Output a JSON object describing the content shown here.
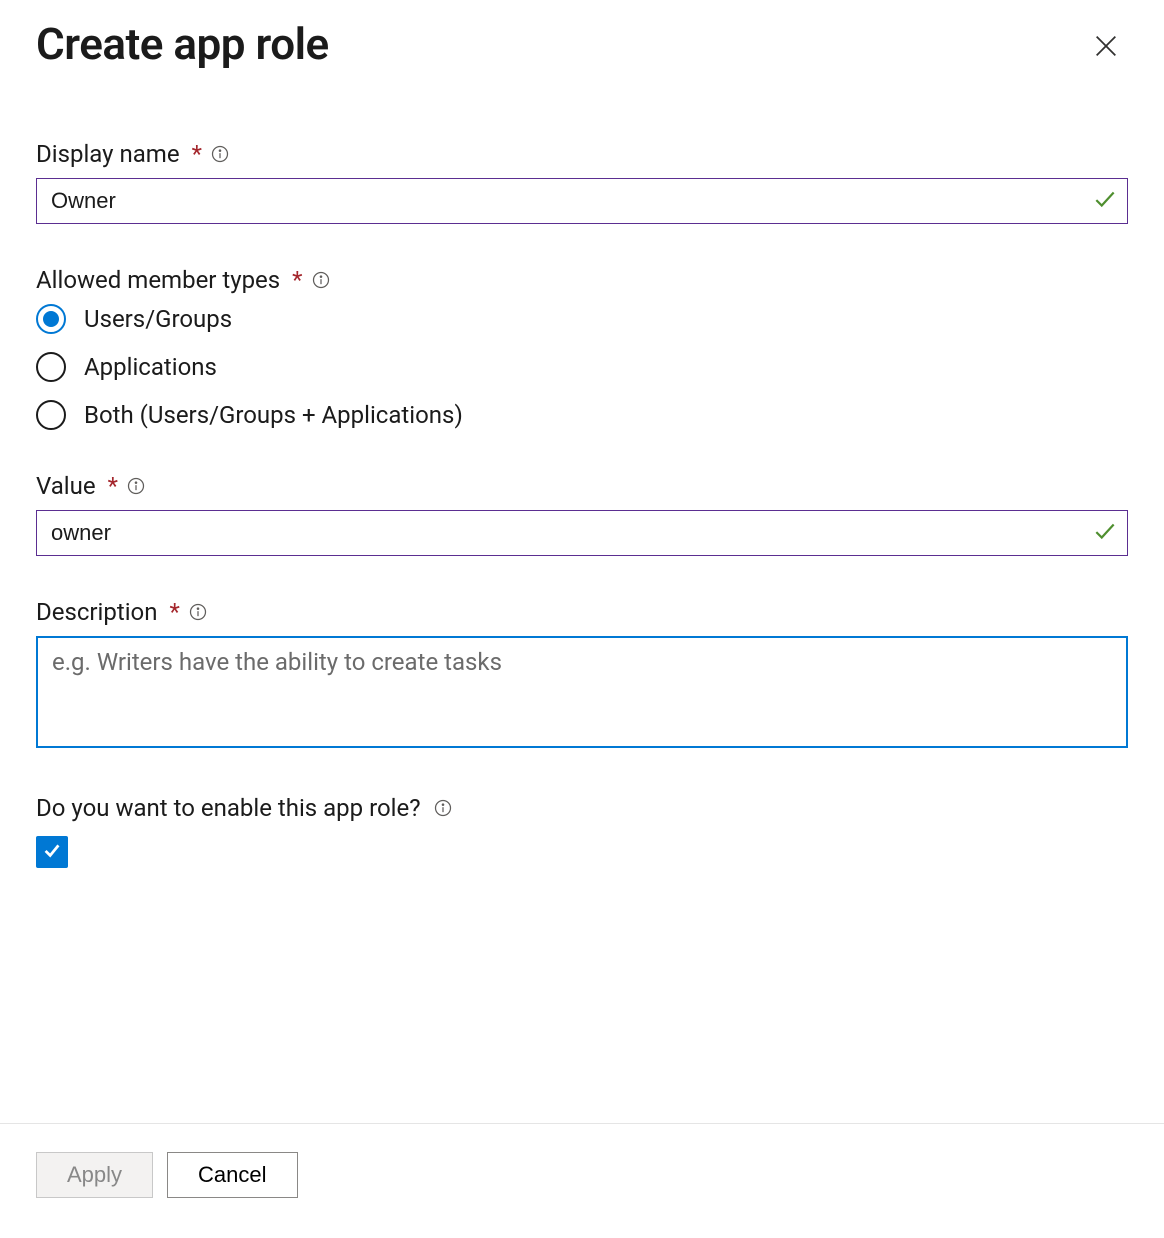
{
  "header": {
    "title": "Create app role"
  },
  "fields": {
    "displayName": {
      "label": "Display name",
      "value": "Owner",
      "required": "*"
    },
    "allowedMemberTypes": {
      "label": "Allowed member types",
      "required": "*",
      "options": {
        "usersGroups": "Users/Groups",
        "applications": "Applications",
        "both": "Both (Users/Groups + Applications)"
      },
      "selected": "usersGroups"
    },
    "value": {
      "label": "Value",
      "value": "owner",
      "required": "*"
    },
    "description": {
      "label": "Description",
      "required": "*",
      "placeholder": "e.g. Writers have the ability to create tasks",
      "value": ""
    },
    "enable": {
      "label": "Do you want to enable this app role?",
      "checked": true
    }
  },
  "footer": {
    "apply": "Apply",
    "cancel": "Cancel"
  }
}
